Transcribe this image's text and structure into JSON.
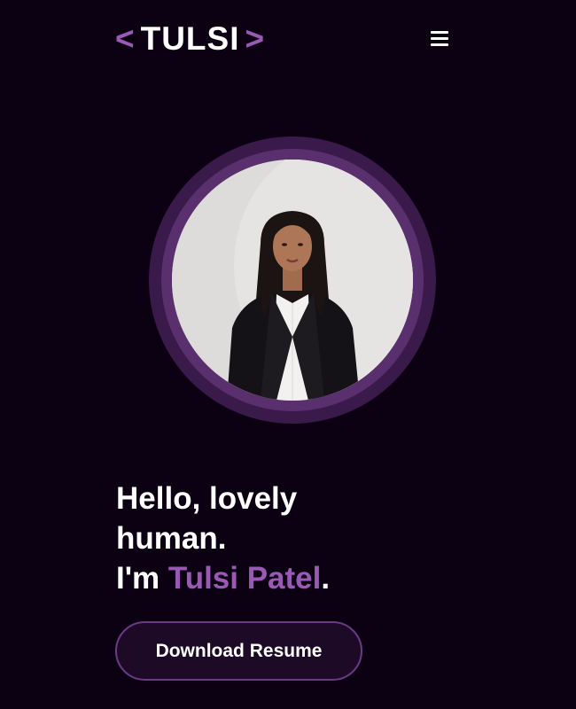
{
  "header": {
    "logo_open": "<",
    "logo_name": "TULSI",
    "logo_close": ">",
    "menu_icon": "hamburger-menu-icon"
  },
  "hero": {
    "line1": "Hello, lovely",
    "line2": "human.",
    "line3_prefix": "I'm ",
    "line3_name": "Tulsi Patel",
    "line3_suffix": ".",
    "cta_label": "Download Resume"
  },
  "colors": {
    "background": "#0b0112",
    "accent": "#9b59b6",
    "ring": "#5a2f6e",
    "text": "#ffffff"
  }
}
